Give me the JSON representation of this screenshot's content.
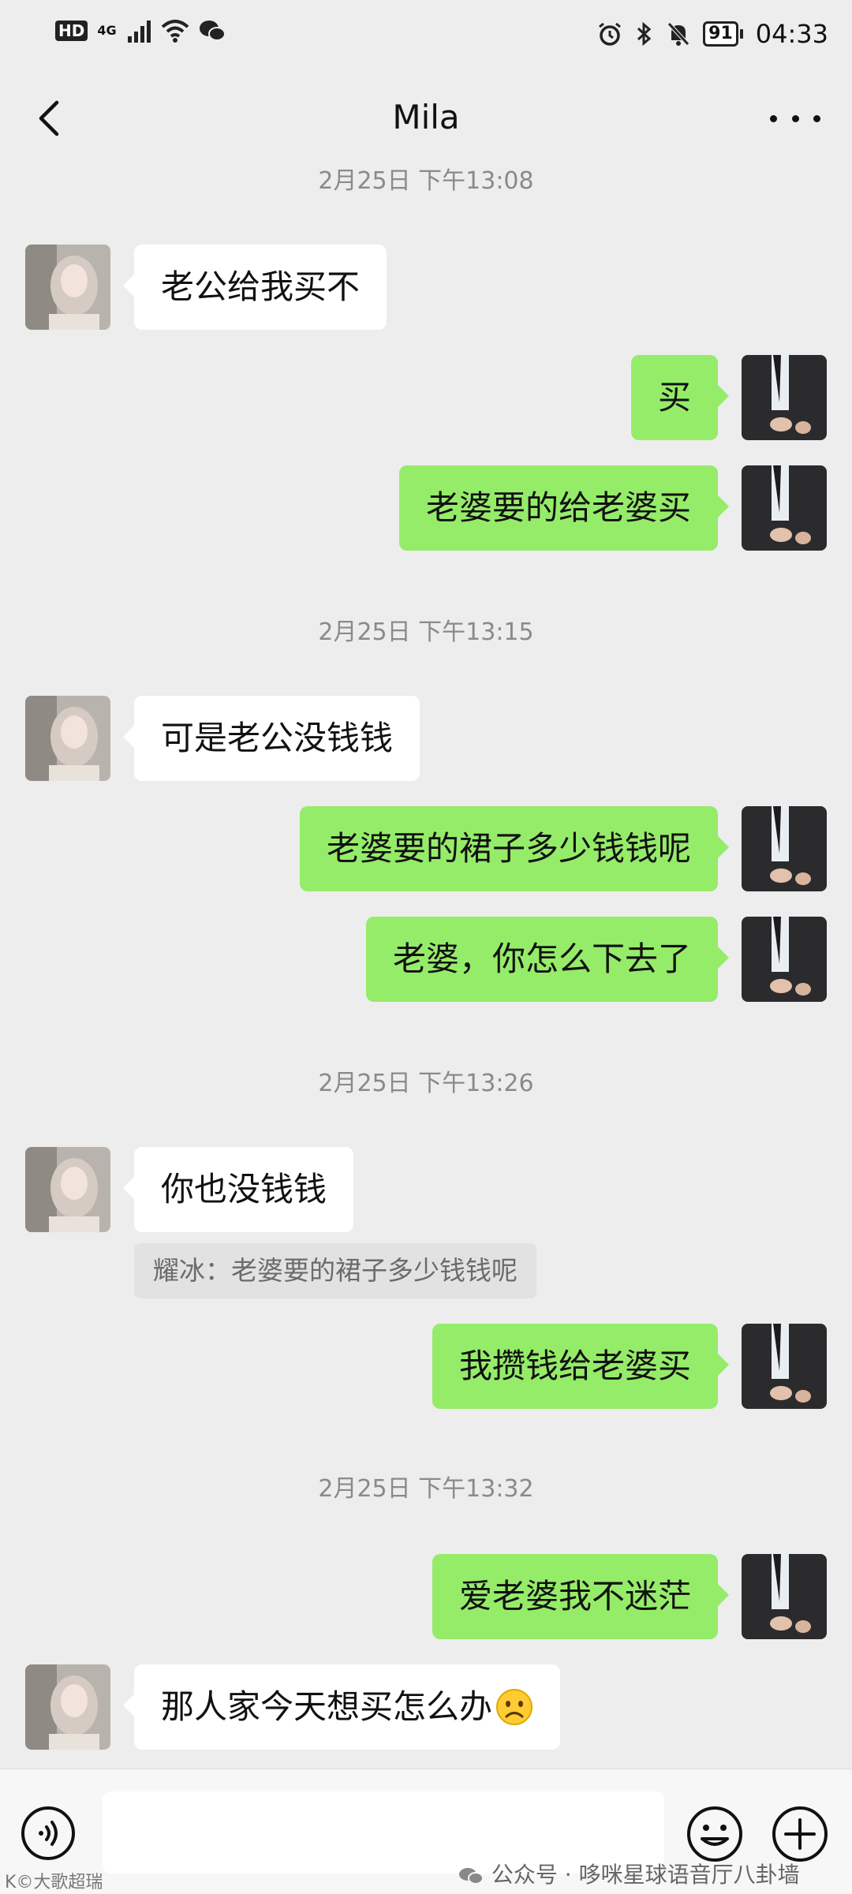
{
  "status_bar": {
    "hd": "HD",
    "network": "4G",
    "battery": "91",
    "time": "04:33"
  },
  "header": {
    "title": "Mila"
  },
  "messages": [
    {
      "type": "timestamp",
      "text": "2月25日 下午13:08"
    },
    {
      "type": "message",
      "side": "left",
      "text": "老公给我买不"
    },
    {
      "type": "message",
      "side": "right",
      "text": "买"
    },
    {
      "type": "message",
      "side": "right",
      "text": "老婆要的给老婆买"
    },
    {
      "type": "timestamp",
      "text": "2月25日 下午13:15"
    },
    {
      "type": "message",
      "side": "left",
      "text": "可是老公没钱钱"
    },
    {
      "type": "message",
      "side": "right",
      "text": "老婆要的裙子多少钱钱呢"
    },
    {
      "type": "message",
      "side": "right",
      "text": "老婆，你怎么下去了"
    },
    {
      "type": "timestamp",
      "text": "2月25日 下午13:26"
    },
    {
      "type": "message",
      "side": "left",
      "text": "你也没钱钱"
    },
    {
      "type": "quote",
      "text": "耀冰：老婆要的裙子多少钱钱呢"
    },
    {
      "type": "message",
      "side": "right",
      "text": "我攒钱给老婆买"
    },
    {
      "type": "timestamp",
      "text": "2月25日 下午13:32"
    },
    {
      "type": "message",
      "side": "right",
      "text": "爱老婆我不迷茫"
    },
    {
      "type": "message",
      "side": "left",
      "text": "那人家今天想买怎么办",
      "emoji": "frowning-face"
    }
  ],
  "input_bar": {
    "text_value": ""
  },
  "watermark": {
    "text": "公众号 · 哆咪星球语音厅八卦墙",
    "corner": "K©大歌超瑞"
  },
  "colors": {
    "background": "#ededed",
    "bubble_left": "#ffffff",
    "bubble_right": "#95ec69",
    "timestamp_text": "#8a8a8a"
  }
}
